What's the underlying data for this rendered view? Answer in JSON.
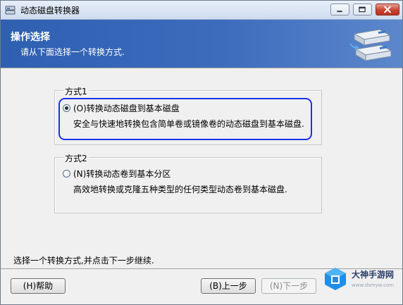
{
  "window": {
    "title": "动态磁盘转换器"
  },
  "header": {
    "title": "操作选择",
    "subtitle": "请从下面选择一个转换方式."
  },
  "groups": [
    {
      "label": "方式1",
      "option_label": "(O)转换动态磁盘到基本磁盘",
      "description": "安全与快速地转换包含简单卷或镜像卷的动态磁盘到基本磁盘.",
      "selected": true
    },
    {
      "label": "方式2",
      "option_label": "(N)转换动态卷到基本分区",
      "description": "高效地转换或克隆五种类型的任何类型动态卷到基本磁盘.",
      "selected": false
    }
  ],
  "footer": {
    "instruction": "选择一个转换方式,并点击下一步继续.",
    "help_label": "(H)帮助",
    "back_label": "(B)上一步",
    "next_label": "(N)下一步",
    "next_disabled": true
  },
  "watermark": {
    "text": "大神手游网",
    "url": "www.dsmyw.com"
  },
  "colors": {
    "header_bg": "#2e5fb0",
    "focus_ring": "#1a32e8",
    "close_button": "#c7432f"
  },
  "icons": [
    "app-icon",
    "minimize-icon",
    "maximize-icon",
    "close-icon",
    "disk-converter-icon",
    "radio-selected-icon",
    "radio-unselected-icon",
    "watermark-logo-icon"
  ]
}
